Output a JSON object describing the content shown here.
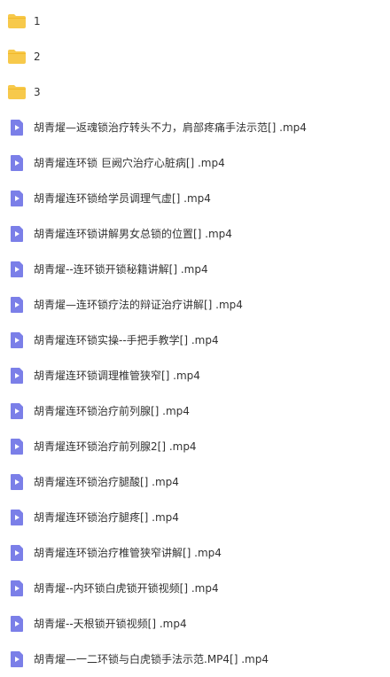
{
  "colors": {
    "folder": "#f7c94b",
    "folder_tab": "#f2b928",
    "video": "#7b7fe8",
    "video_play": "#ffffff",
    "text": "#333333"
  },
  "folders": [
    {
      "name": "1",
      "icon": "folder-icon"
    },
    {
      "name": "2",
      "icon": "folder-icon"
    },
    {
      "name": "3",
      "icon": "folder-icon"
    }
  ],
  "files": [
    {
      "name": "胡青燿—返魂锁治疗转头不力，肩部疼痛手法示范[] .mp4",
      "icon": "video-file-icon"
    },
    {
      "name": "胡青燿连环锁 巨阙穴治疗心脏病[] .mp4",
      "icon": "video-file-icon"
    },
    {
      "name": "胡青燿连环锁给学员调理气虚[] .mp4",
      "icon": "video-file-icon"
    },
    {
      "name": "胡青燿连环锁讲解男女总锁的位置[] .mp4",
      "icon": "video-file-icon"
    },
    {
      "name": "胡青燿--连环锁开锁秘籍讲解[] .mp4",
      "icon": "video-file-icon"
    },
    {
      "name": "胡青燿—连环锁疗法的辩证治疗讲解[] .mp4",
      "icon": "video-file-icon"
    },
    {
      "name": "胡青燿连环锁实操--手把手教学[] .mp4",
      "icon": "video-file-icon"
    },
    {
      "name": "胡青燿连环锁调理椎管狭窄[] .mp4",
      "icon": "video-file-icon"
    },
    {
      "name": "胡青燿连环锁治疗前列腺[] .mp4",
      "icon": "video-file-icon"
    },
    {
      "name": "胡青燿连环锁治疗前列腺2[] .mp4",
      "icon": "video-file-icon"
    },
    {
      "name": "胡青燿连环锁治疗腿酸[] .mp4",
      "icon": "video-file-icon"
    },
    {
      "name": "胡青燿连环锁治疗腿疼[] .mp4",
      "icon": "video-file-icon"
    },
    {
      "name": "胡青燿连环锁治疗椎管狭窄讲解[] .mp4",
      "icon": "video-file-icon"
    },
    {
      "name": "胡青燿--内环锁白虎锁开锁视频[] .mp4",
      "icon": "video-file-icon"
    },
    {
      "name": "胡青燿--天根锁开锁视频[] .mp4",
      "icon": "video-file-icon"
    },
    {
      "name": "胡青燿—一二环锁与白虎锁手法示范.MP4[] .mp4",
      "icon": "video-file-icon"
    }
  ]
}
